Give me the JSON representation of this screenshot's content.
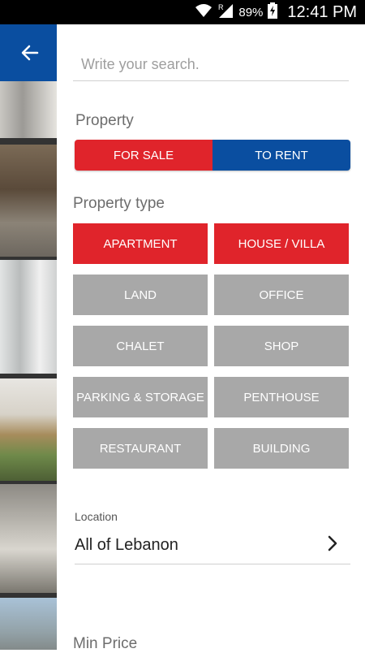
{
  "status_bar": {
    "battery_percent": "89%",
    "time": "12:41 PM",
    "icons": [
      "wifi-icon",
      "signal-icon",
      "battery-charging-icon"
    ]
  },
  "app_bar": {
    "back_icon": "arrow-left-icon",
    "color": "#0a4ea0"
  },
  "search": {
    "placeholder": "Write your search.",
    "value": ""
  },
  "property": {
    "title": "Property",
    "options": [
      {
        "label": "FOR SALE",
        "color": "#e0242b"
      },
      {
        "label": "TO RENT",
        "color": "#0a4ea0"
      }
    ]
  },
  "property_type": {
    "title": "Property type",
    "active_color": "#e0242b",
    "inactive_color": "#a8a8a8",
    "items": [
      {
        "label": "APARTMENT",
        "selected": true
      },
      {
        "label": "HOUSE / VILLA",
        "selected": true
      },
      {
        "label": "LAND",
        "selected": false
      },
      {
        "label": "OFFICE",
        "selected": false
      },
      {
        "label": "CHALET",
        "selected": false
      },
      {
        "label": "SHOP",
        "selected": false
      },
      {
        "label": "PARKING & STORAGE",
        "selected": false
      },
      {
        "label": "PENTHOUSE",
        "selected": false
      },
      {
        "label": "RESTAURANT",
        "selected": false
      },
      {
        "label": "BUILDING",
        "selected": false
      }
    ]
  },
  "location": {
    "label": "Location",
    "value": "All of Lebanon",
    "chevron_icon": "chevron-right-icon"
  },
  "min_price": {
    "label": "Min Price"
  }
}
